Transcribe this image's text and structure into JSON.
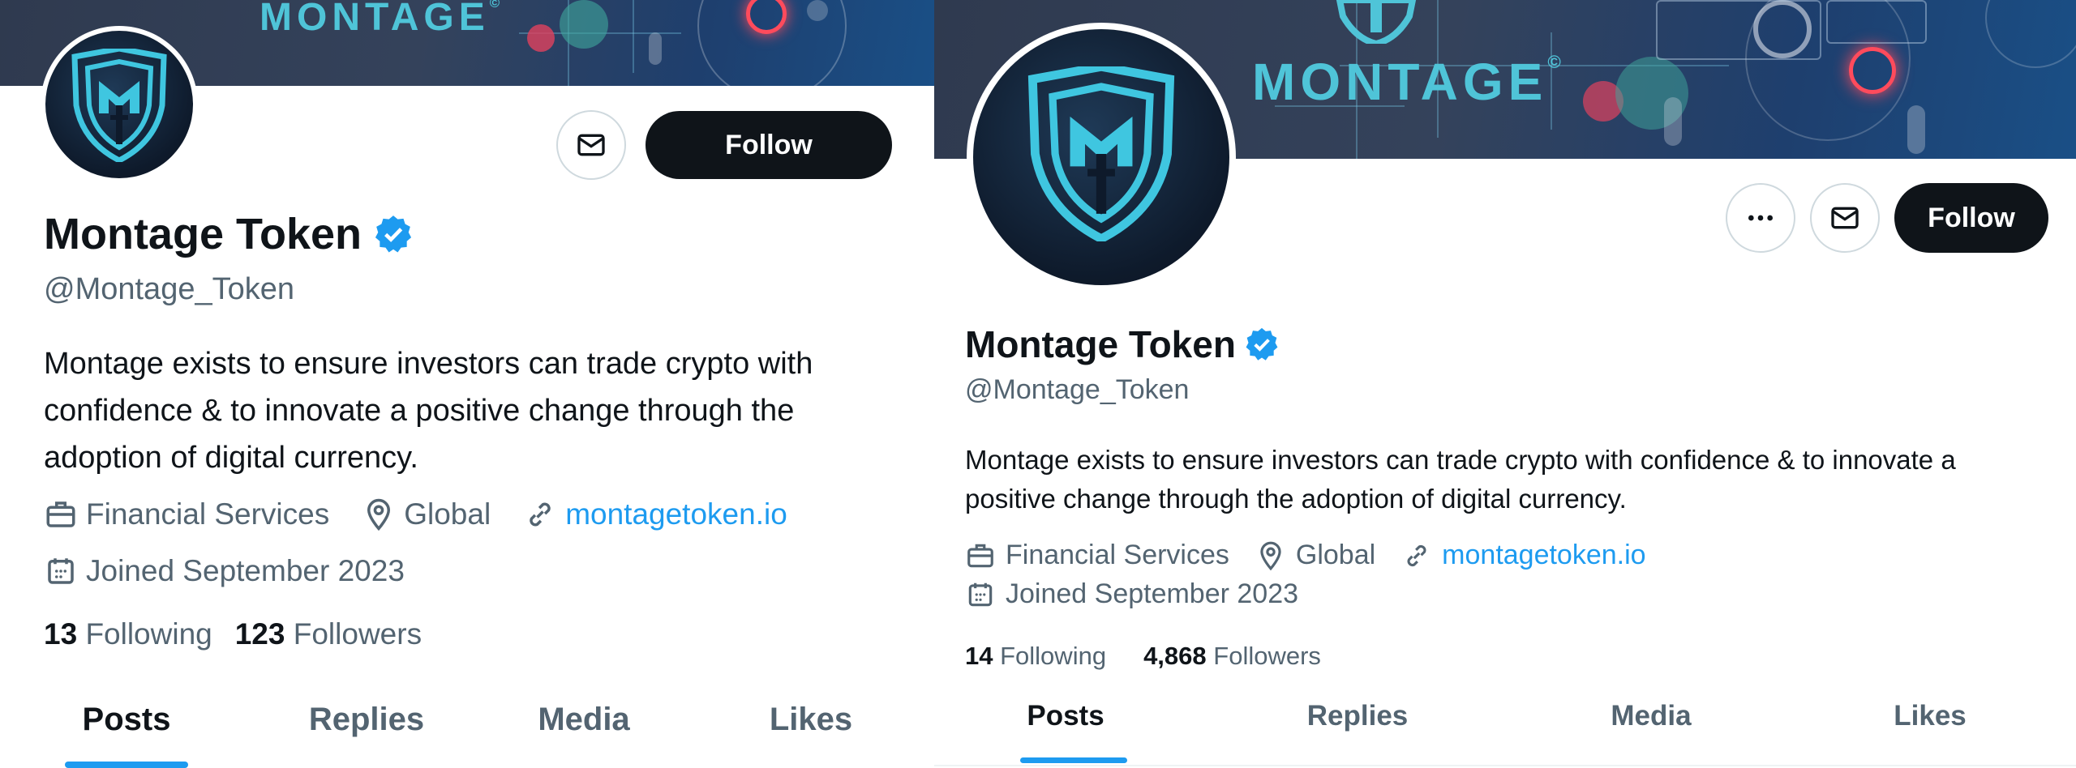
{
  "colors": {
    "accent": "#1d9bf0",
    "text": "#0f1419",
    "secondary": "#536471",
    "button": "#0f1419",
    "border": "#cfd9de",
    "brand": "#4fc4d8"
  },
  "left": {
    "banner_text": "MONTAGE",
    "banner_mark": "©",
    "follow_label": "Follow",
    "name": "Montage Token",
    "handle": "@Montage_Token",
    "bio": "Montage exists to ensure investors can trade crypto with confidence & to innovate a positive change through the adoption of digital currency.",
    "category": "Financial Services",
    "location": "Global",
    "website": "montagetoken.io",
    "joined": "Joined September 2023",
    "following_count": "13",
    "following_label": "Following",
    "followers_count": "123",
    "followers_label": "Followers",
    "tabs": [
      "Posts",
      "Replies",
      "Media",
      "Likes"
    ],
    "active_tab": "Posts"
  },
  "right": {
    "banner_text": "MONTAGE",
    "banner_mark": "©",
    "follow_label": "Follow",
    "name": "Montage Token",
    "handle": "@Montage_Token",
    "bio": "Montage exists to ensure investors can trade crypto with confidence & to innovate a positive change through the adoption of digital currency.",
    "category": "Financial Services",
    "location": "Global",
    "website": "montagetoken.io",
    "joined": "Joined September 2023",
    "following_count": "14",
    "following_label": "Following",
    "followers_count": "4,868",
    "followers_label": "Followers",
    "tabs": [
      "Posts",
      "Replies",
      "Media",
      "Likes"
    ],
    "active_tab": "Posts"
  },
  "icons": {
    "verified": "verified-badge-icon",
    "message": "envelope-icon",
    "more": "more-dots-icon",
    "category": "briefcase-icon",
    "location": "location-pin-icon",
    "website": "link-icon",
    "joined": "calendar-icon"
  }
}
